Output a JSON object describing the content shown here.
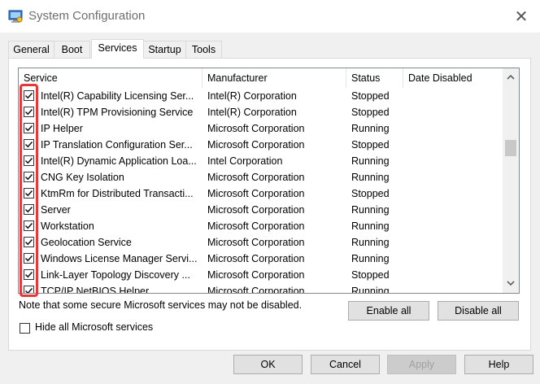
{
  "window": {
    "title": "System Configuration",
    "close_glyph": "✕"
  },
  "tabs": [
    {
      "label": "General",
      "active": false
    },
    {
      "label": "Boot",
      "active": false
    },
    {
      "label": "Services",
      "active": true
    },
    {
      "label": "Startup",
      "active": false
    },
    {
      "label": "Tools",
      "active": false
    }
  ],
  "table": {
    "headers": [
      "Service",
      "Manufacturer",
      "Status",
      "Date Disabled"
    ],
    "rows": [
      {
        "checked": true,
        "service": "Intel(R) Capability Licensing Ser...",
        "manufacturer": "Intel(R) Corporation",
        "status": "Stopped",
        "date_disabled": ""
      },
      {
        "checked": true,
        "service": "Intel(R) TPM Provisioning Service",
        "manufacturer": "Intel(R) Corporation",
        "status": "Stopped",
        "date_disabled": ""
      },
      {
        "checked": true,
        "service": "IP Helper",
        "manufacturer": "Microsoft Corporation",
        "status": "Running",
        "date_disabled": ""
      },
      {
        "checked": true,
        "service": "IP Translation Configuration Ser...",
        "manufacturer": "Microsoft Corporation",
        "status": "Stopped",
        "date_disabled": ""
      },
      {
        "checked": true,
        "service": "Intel(R) Dynamic Application Loa...",
        "manufacturer": "Intel Corporation",
        "status": "Running",
        "date_disabled": ""
      },
      {
        "checked": true,
        "service": "CNG Key Isolation",
        "manufacturer": "Microsoft Corporation",
        "status": "Running",
        "date_disabled": ""
      },
      {
        "checked": true,
        "service": "KtmRm for Distributed Transacti...",
        "manufacturer": "Microsoft Corporation",
        "status": "Stopped",
        "date_disabled": ""
      },
      {
        "checked": true,
        "service": "Server",
        "manufacturer": "Microsoft Corporation",
        "status": "Running",
        "date_disabled": ""
      },
      {
        "checked": true,
        "service": "Workstation",
        "manufacturer": "Microsoft Corporation",
        "status": "Running",
        "date_disabled": ""
      },
      {
        "checked": true,
        "service": "Geolocation Service",
        "manufacturer": "Microsoft Corporation",
        "status": "Running",
        "date_disabled": ""
      },
      {
        "checked": true,
        "service": "Windows License Manager Servi...",
        "manufacturer": "Microsoft Corporation",
        "status": "Running",
        "date_disabled": ""
      },
      {
        "checked": true,
        "service": "Link-Layer Topology Discovery ...",
        "manufacturer": "Microsoft Corporation",
        "status": "Stopped",
        "date_disabled": ""
      },
      {
        "checked": true,
        "service": "TCP/IP NetBIOS Helper",
        "manufacturer": "Microsoft Corporation",
        "status": "Running",
        "date_disabled": ""
      }
    ]
  },
  "note": "Note that some secure Microsoft services may not be disabled.",
  "buttons": {
    "enable_all": "Enable all",
    "disable_all": "Disable all",
    "ok": "OK",
    "cancel": "Cancel",
    "apply": "Apply",
    "help": "Help"
  },
  "hide_all": {
    "label": "Hide all Microsoft services",
    "checked": false
  },
  "colors": {
    "highlight": "#e03a3a",
    "list_border": "#828790"
  },
  "icons": {
    "app": "system-config-icon",
    "close": "close-icon",
    "scroll_up": "chevron-up-icon",
    "scroll_down": "chevron-down-icon"
  }
}
